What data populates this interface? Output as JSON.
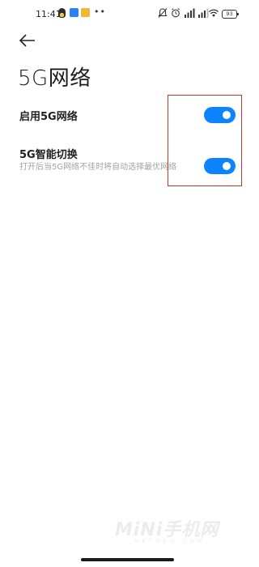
{
  "status_bar": {
    "time": "11:41",
    "left_icons": [
      "qq-icon",
      "app-icon",
      "app-icon",
      "more-icon"
    ],
    "right_icons": [
      "mute-icon",
      "alarm-icon",
      "signal-icon",
      "signal-icon",
      "wifi-icon"
    ],
    "battery_level": "93"
  },
  "page": {
    "title": "5G网络"
  },
  "settings": [
    {
      "label": "启用5G网络",
      "description": "",
      "enabled": true
    },
    {
      "label": "5G智能切换",
      "description": "打开后当5G网络不佳时将自动选择最优网络",
      "enabled": true
    }
  ],
  "watermark": {
    "main": "MiNi手机网",
    "sub": "NETOEO.COM"
  },
  "colors": {
    "toggle_on": "#0d84ff",
    "highlight": "#c0392b"
  }
}
